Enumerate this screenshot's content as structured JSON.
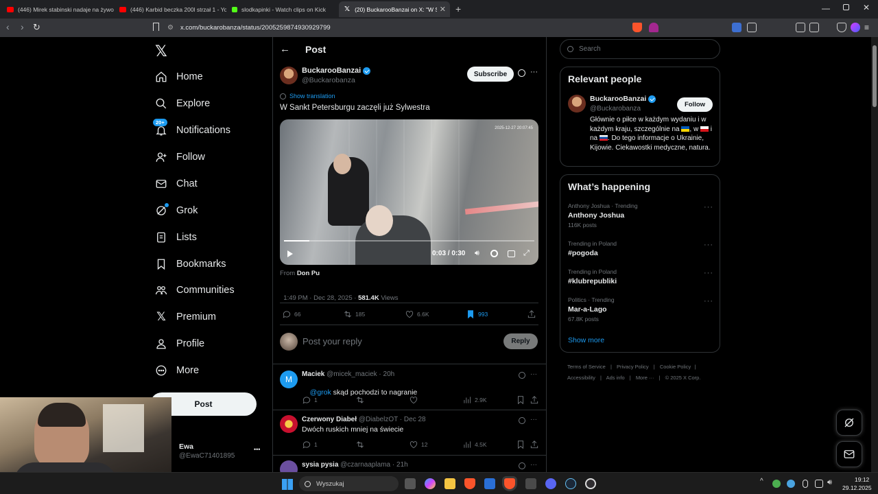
{
  "browser": {
    "tabs": [
      {
        "title": "(446) Mirek stabinski nadaje na żywo",
        "color": "#ff0000"
      },
      {
        "title": "(446) Karbid beczka 200l strzał 1 - Yo",
        "color": "#ff0000"
      },
      {
        "title": "slodkapinki - Watch clips on Kick",
        "color": "#53fc18"
      },
      {
        "title": "(20) BuckarooBanzai on X: \"W Sa",
        "color": "#ffffff"
      }
    ],
    "new_tab": "+",
    "url": "x.com/buckarobanza/status/2005259874930929799"
  },
  "sidebar": {
    "items": [
      {
        "label": "Home",
        "icon": "home-icon"
      },
      {
        "label": "Explore",
        "icon": "search-icon"
      },
      {
        "label": "Notifications",
        "icon": "bell-icon",
        "badge": "20+"
      },
      {
        "label": "Follow",
        "icon": "follow-icon"
      },
      {
        "label": "Chat",
        "icon": "mail-icon"
      },
      {
        "label": "Grok",
        "icon": "grok-icon"
      },
      {
        "label": "Lists",
        "icon": "list-icon"
      },
      {
        "label": "Bookmarks",
        "icon": "bookmark-icon"
      },
      {
        "label": "Communities",
        "icon": "communities-icon"
      },
      {
        "label": "Premium",
        "icon": "x-icon"
      },
      {
        "label": "Profile",
        "icon": "person-icon"
      },
      {
        "label": "More",
        "icon": "more-icon"
      }
    ],
    "post_button": "Post",
    "account": {
      "name": "Ewa",
      "handle": "@EwaC71401895",
      "more": "•••"
    }
  },
  "header": {
    "title": "Post"
  },
  "tweet": {
    "author": "BuckarooBanzai",
    "handle": "@Buckarobanza",
    "subscribe": "Subscribe",
    "show_translation": "Show translation",
    "text": "W Sankt Petersburgu zaczęli już Sylwestra",
    "video": {
      "timestamp": "2025-12-27 20:07:45",
      "time": "0:03 / 0:30",
      "progress": 0.1
    },
    "from_label": "From",
    "from_name": "Don Pu",
    "meta": "1:49 PM · Dec 28, 2025 · ",
    "views_count": "581.4K",
    "views_label": " Views",
    "stats": {
      "replies": "66",
      "reposts": "185",
      "likes": "6.6K",
      "bookmarks": "993"
    },
    "reply_placeholder": "Post your reply",
    "reply_button": "Reply"
  },
  "replies": [
    {
      "name": "Maciek",
      "handle": "@micek_maciek · 20h",
      "mention": "@grok",
      "text": " skąd pochodzi to nagranie",
      "replies": "1",
      "reposts": "",
      "likes": "",
      "views": "2.9K",
      "avatar_letter": "M",
      "avatar_color": "#1d9bf0"
    },
    {
      "name": "Czerwony Diabeł",
      "handle": "@DiabelzOT · Dec 28",
      "mention": "",
      "text": "Dwóch ruskich mniej na świecie",
      "replies": "1",
      "reposts": "",
      "likes": "12",
      "views": "4.5K",
      "avatar_letter": "",
      "avatar_color": "#c8102e"
    },
    {
      "name": "sysia pysia",
      "handle": "@czarnaaplama · 21h",
      "mention": "",
      "text": "",
      "replies": "",
      "reposts": "",
      "likes": "",
      "views": "",
      "avatar_letter": "",
      "avatar_color": "#6b4fa0"
    }
  ],
  "search": {
    "placeholder": "Search"
  },
  "relevant": {
    "title": "Relevant people",
    "name": "BuckarooBanzai",
    "handle": "@Buckarobanza",
    "follow": "Follow",
    "bio_1": "Głównie o piłce w każdym wydaniu i w każdym kraju, szczególnie na ",
    "bio_2": ", w ",
    "bio_3": " i na ",
    "bio_4": ". Do tego informacje o Ukrainie, Kijowie. Ciekawostki medyczne, natura."
  },
  "happening": {
    "title": "What’s happening",
    "trends": [
      {
        "meta": "Anthony Joshua · Trending",
        "name": "Anthony Joshua",
        "posts": "116K posts"
      },
      {
        "meta": "Trending in Poland",
        "name": "#pogoda",
        "posts": ""
      },
      {
        "meta": "Trending in Poland",
        "name": "#klubrepubliki",
        "posts": ""
      },
      {
        "meta": "Politics · Trending",
        "name": "Mar-a-Lago",
        "posts": "67.8K posts"
      }
    ],
    "show_more": "Show more"
  },
  "footer": {
    "links": [
      "Terms of Service",
      "Privacy Policy",
      "Cookie Policy",
      "Accessibility",
      "Ads info",
      "More ···",
      "© 2025 X Corp."
    ]
  },
  "taskbar": {
    "search": "Wyszukaj",
    "time": "19:12",
    "date": "29.12.2025"
  },
  "colors": {
    "accent": "#1d9bf0",
    "background": "#000000",
    "border": "#2f3336",
    "muted": "#71767b"
  }
}
